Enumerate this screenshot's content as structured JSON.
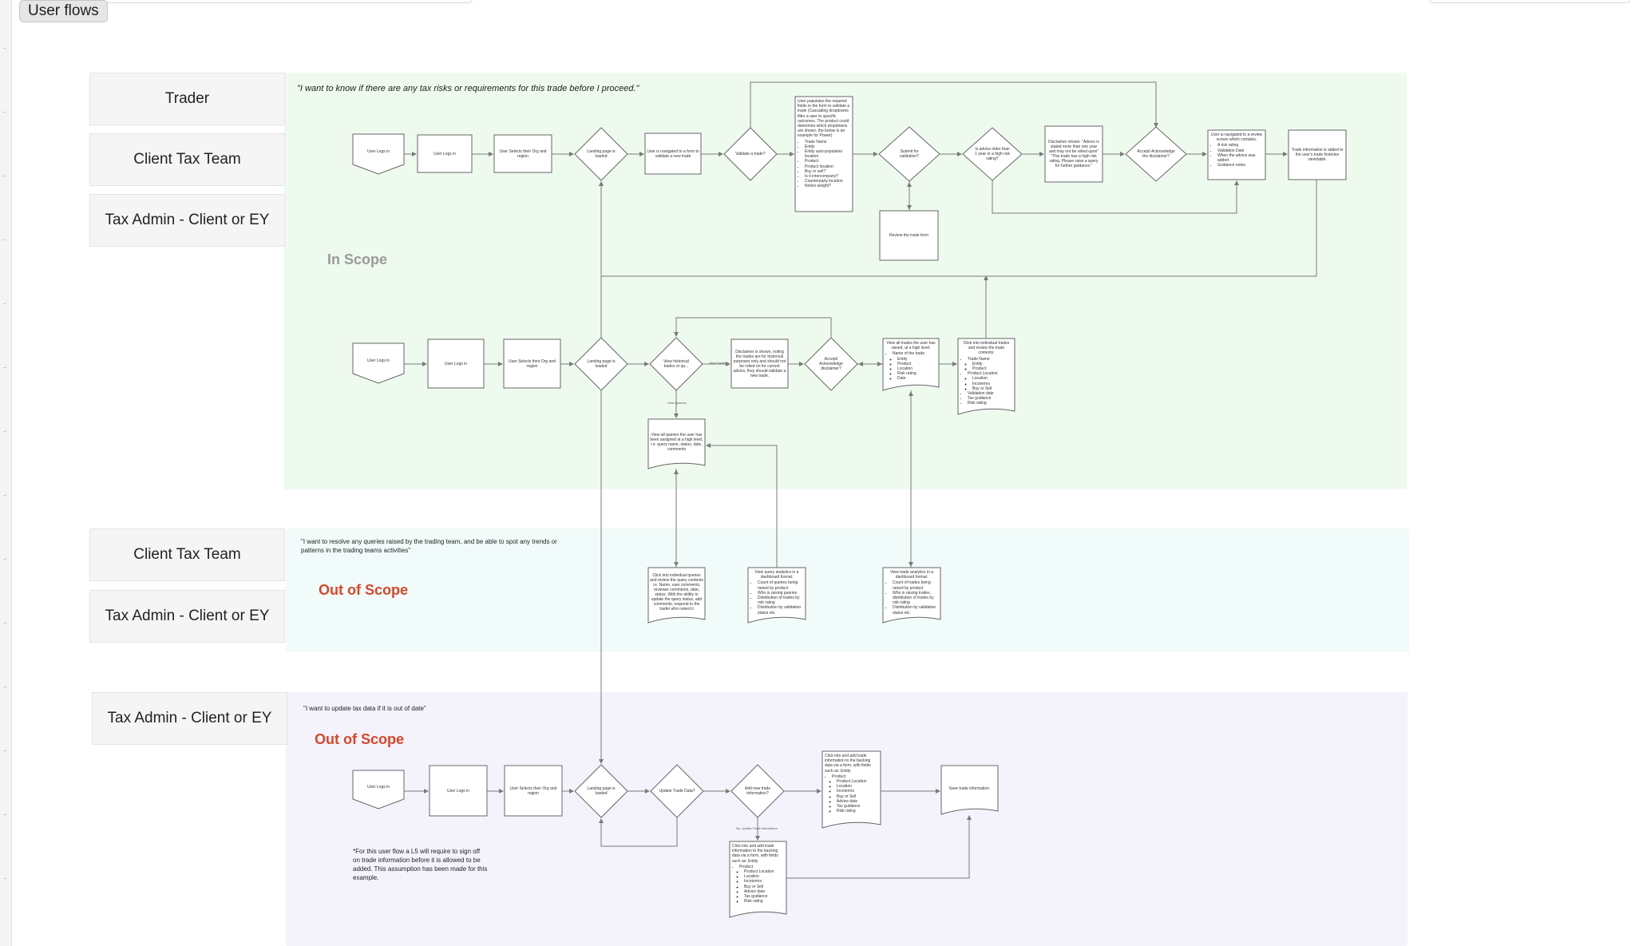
{
  "page": {
    "tag": "User flows"
  },
  "colors": {
    "in_scope_bg": "#eefaee",
    "out_scope_mint_bg": "#f1fcfa",
    "out_scope_lavender_bg": "#f4f2fb",
    "out_scope_red": "#d9462a",
    "in_scope_grey": "#9a9a9a"
  },
  "section1": {
    "roles": [
      "Trader",
      "Client Tax Team",
      "Tax Admin - Client or EY"
    ],
    "quote": "\"I want to know if there are any tax risks or requirements for this trade before I proceed.\"",
    "scope": "In Scope",
    "flowA": {
      "user_logs_in": "User Logs in",
      "user_logs_in2": "User Logs in",
      "select_org": "User Selects their Org and region",
      "landing": "Landing page is loaded",
      "navigated": "User is navigated to a form to validate a new trade",
      "validate": "Validate a trade?",
      "form_intro": "User populates the required fields in the form to validate a trade (Cascading dropdowns filter a user to specific outcomes. The product could determine which dropdowns are shown, the below is an example for Power):",
      "form_items": [
        "Trade Name",
        "Entity",
        "Entity auto-populates location",
        "Product",
        "Product location",
        "Buy or sell?",
        "Is it intercompany?",
        "Counterparty location",
        "Notice weight?"
      ],
      "submit": "Submit for validation?",
      "review": "Review the trade form",
      "advice_older": "Is advice older than 1 year or a high risk rating?",
      "disclaimer_text": "Disclaimer shown: \"Advice is stated more than one year and may not be relied upon\" \"This trade has a high risk rating. Please raise a query for further guidance.\"",
      "accept": "Accept/ Acknowledge the disclaimer?",
      "redirected_intro": "User is navigated to a review screen which contains:",
      "redirected_items": [
        "A risk rating",
        "Validation Date",
        "When the advice was added",
        "Guidance notes"
      ],
      "history": "Trade information is added to the user's trade histories view/table."
    },
    "flowB": {
      "user_logs_in": "User Logs in",
      "user_logs_in2": "User Logs in",
      "select_org": "User Selects their Org and region",
      "landing": "Landing page is loaded",
      "view_hist": "View historical trades or qu...",
      "disclaimer": "Disclaimer is shown, noting the trades are for historical purposes only and should not be relied on for current advice, they should validate a new trade.",
      "accept": "Accept/ Acknowledge disclaimer?",
      "view_trades_intro": "View all trades the user has raised, at a high level:",
      "view_trades_items": [
        "Name of the trade",
        "Entity",
        "Product",
        "Location",
        "Risk rating",
        "Date"
      ],
      "click_trade_intro": "Click into individual trades and review the trade contents:",
      "click_trade_items": [
        "Trade Name",
        "Entity",
        "Product",
        "Product Location",
        "Location",
        "Incoterms",
        "Buy or Sell",
        "Validation date",
        "Tax guidance",
        "Risk rating"
      ],
      "queries": "View all queries the user has been assigned at a high level, i.e. query name, status, date, comments",
      "label_view_trades": "View Trades",
      "label_view_queries": "View Queries"
    }
  },
  "section2": {
    "roles": [
      "Client Tax Team",
      "Tax Admin - Client or EY"
    ],
    "quote": "\"I want to resolve any queries raised by the trading team, and be able to spot any trends or patterns in the trading teams activities\"",
    "scope": "Out of Scope",
    "click_queries": "Click into individual queries and review the query contents i.e. Name, user comments, reviewer comments, date, status. With the ability to update the query status, add comments, respond to the trader who raised it",
    "query_analytics_intro": "View query analytics in a dashboard format:",
    "query_analytics_items": [
      "Count of queries being raised by product",
      "Who is raising queries",
      "Distribution of trades by risk rating",
      "Distribution by validation status etc."
    ],
    "trade_analytics_intro": "View trade analytics in a dashboard format:",
    "trade_analytics_items": [
      "Count of trades being raised by product",
      "Who is raising trades, distribution of trades by risk rating",
      "Distribution by validation status etc."
    ]
  },
  "section3": {
    "role": "Tax Admin - Client or EY",
    "quote": "\"I want to update tax data if it is out of date\"",
    "scope": "Out of Scope",
    "user_logs_in": "User Logs in",
    "user_logs_in2": "User Logs in",
    "select_org": "User Selects their Org and region",
    "landing": "Landing page is loaded",
    "update": "Update Trade Data?",
    "add_new": "Add new trade information?",
    "click_add_intro": "Click into and add trade information to the backing data via a form, with fields such as: Entity",
    "click_add_items": [
      "Product",
      "Product Location",
      "Location",
      "Incoterms",
      "Buy or Sell",
      "Advice date",
      "Tax guidance",
      "Risk rating"
    ],
    "click_add2_intro": "Click into and add trade information to the backing data via a form, with fields such as: Entity",
    "click_add2_items": [
      "Product",
      "Product Location",
      "Location",
      "Incoterms",
      "Buy or Sell",
      "Advice date",
      "Tax guidance",
      "Risk rating"
    ],
    "save": "Save trade information.",
    "note": "*For this user flow a L5 will require to sign off on trade information before it is allowed to be added. This assumption has been made for this example.",
    "label_update": "No, update Trade information"
  }
}
